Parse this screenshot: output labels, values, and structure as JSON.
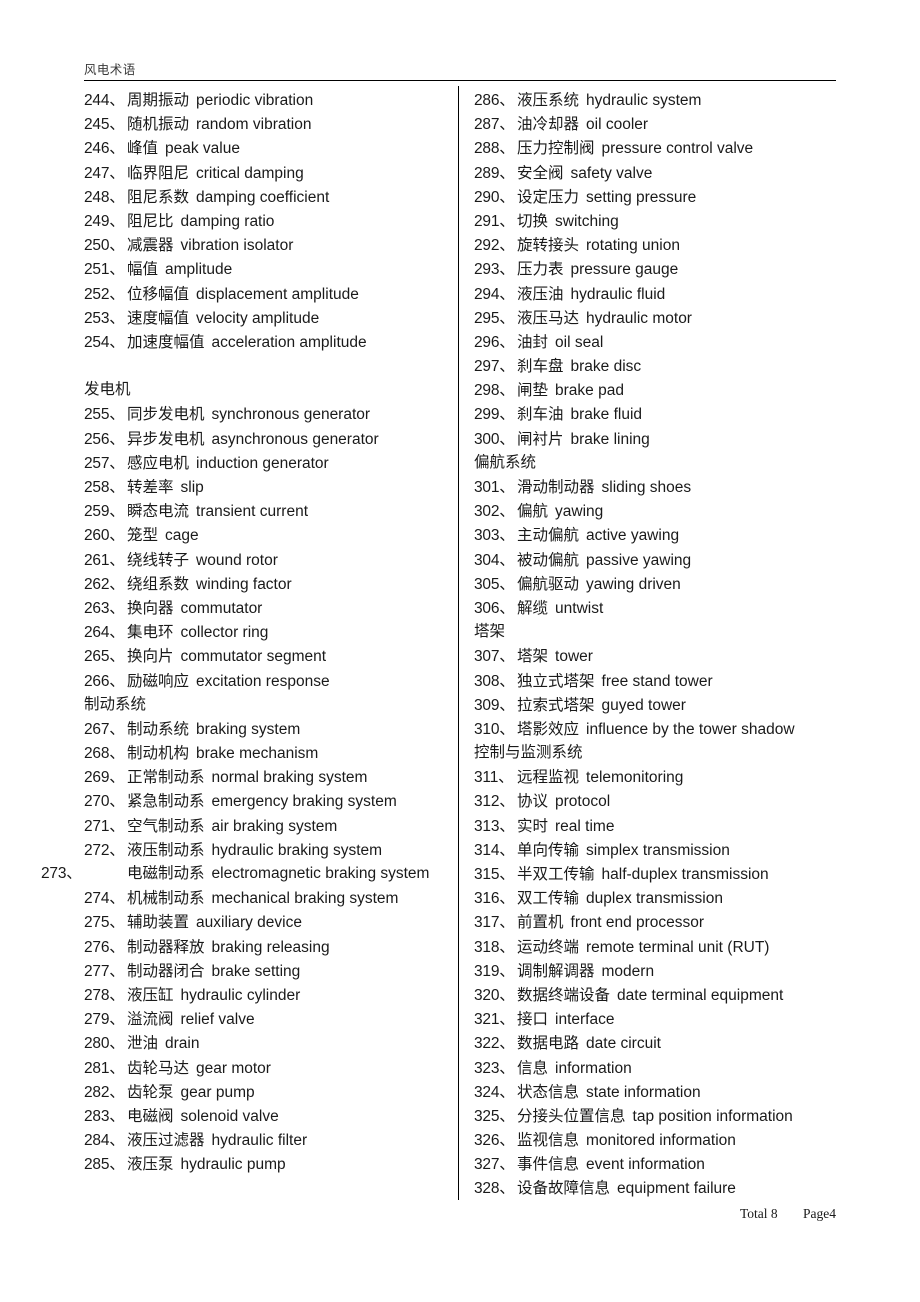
{
  "header": {
    "title": "风电术语"
  },
  "footer": {
    "total_label": "Total 8",
    "page_label": "Page4"
  },
  "columns": {
    "left": [
      {
        "kind": "entry",
        "num": "244、",
        "term": "周期振动",
        "en": "periodic vibration"
      },
      {
        "kind": "entry",
        "num": "245、",
        "term": "随机振动",
        "en": "random vibration"
      },
      {
        "kind": "entry",
        "num": "246、",
        "term": "峰值",
        "en": "peak value"
      },
      {
        "kind": "entry",
        "num": "247、",
        "term": "临界阻尼",
        "en": "critical damping"
      },
      {
        "kind": "entry",
        "num": "248、",
        "term": "阻尼系数",
        "en": "damping coefficient"
      },
      {
        "kind": "entry",
        "num": "249、",
        "term": "阻尼比",
        "en": "damping ratio"
      },
      {
        "kind": "entry",
        "num": "250、",
        "term": "减震器",
        "en": "vibration isolator"
      },
      {
        "kind": "entry",
        "num": "251、",
        "term": "幅值",
        "en": "amplitude"
      },
      {
        "kind": "entry",
        "num": "252、",
        "term": "位移幅值",
        "en": "displacement amplitude"
      },
      {
        "kind": "entry",
        "num": "253、",
        "term": "速度幅值",
        "en": "velocity amplitude"
      },
      {
        "kind": "entry",
        "num": "254、",
        "term": "加速度幅值",
        "en": "acceleration amplitude"
      },
      {
        "kind": "spacer"
      },
      {
        "kind": "section",
        "label": "发电机"
      },
      {
        "kind": "entry",
        "num": "255、",
        "term": "同步发电机",
        "en": "synchronous generator"
      },
      {
        "kind": "entry",
        "num": "256、",
        "term": "异步发电机",
        "en": "asynchronous generator"
      },
      {
        "kind": "entry",
        "num": "257、",
        "term": "感应电机",
        "en": "induction generator"
      },
      {
        "kind": "entry",
        "num": "258、",
        "term": "转差率",
        "en": "slip"
      },
      {
        "kind": "entry",
        "num": "259、",
        "term": "瞬态电流",
        "en": "transient current"
      },
      {
        "kind": "entry",
        "num": "260、",
        "term": "笼型",
        "en": "cage"
      },
      {
        "kind": "entry",
        "num": "261、",
        "term": "绕线转子",
        "en": "wound rotor"
      },
      {
        "kind": "entry",
        "num": "262、",
        "term": "绕组系数",
        "en": "winding factor"
      },
      {
        "kind": "entry",
        "num": "263、",
        "term": "换向器",
        "en": "commutator"
      },
      {
        "kind": "entry",
        "num": "264、",
        "term": "集电环",
        "en": "collector ring"
      },
      {
        "kind": "entry",
        "num": "265、",
        "term": "换向片",
        "en": "commutator segment"
      },
      {
        "kind": "entry",
        "num": "266、",
        "term": "励磁响应",
        "en": "excitation response"
      },
      {
        "kind": "section",
        "label": "制动系统"
      },
      {
        "kind": "entry",
        "num": "267、",
        "term": "制动系统",
        "en": "braking system"
      },
      {
        "kind": "entry",
        "num": "268、",
        "term": "制动机构",
        "en": "brake mechanism"
      },
      {
        "kind": "entry",
        "num": "269、",
        "term": "正常制动系",
        "en": "normal braking system"
      },
      {
        "kind": "entry",
        "num": "270、",
        "term": "紧急制动系",
        "en": "emergency braking system"
      },
      {
        "kind": "entry",
        "num": "271、",
        "term": "空气制动系",
        "en": "air braking system"
      },
      {
        "kind": "entry",
        "num": "272、",
        "term": "液压制动系",
        "en": "hydraulic braking system"
      },
      {
        "kind": "entry-wrap",
        "num": "273、",
        "term": "电磁制动系",
        "en": "electromagnetic braking system"
      },
      {
        "kind": "entry",
        "num": "274、",
        "term": "机械制动系",
        "en": "mechanical braking system"
      },
      {
        "kind": "entry",
        "num": "275、",
        "term": "辅助装置",
        "en": "auxiliary device"
      },
      {
        "kind": "entry",
        "num": "276、",
        "term": "制动器释放",
        "en": "braking releasing"
      },
      {
        "kind": "entry",
        "num": "277、",
        "term": "制动器闭合",
        "en": "brake setting"
      },
      {
        "kind": "entry",
        "num": "278、",
        "term": "液压缸",
        "en": "hydraulic cylinder"
      },
      {
        "kind": "entry",
        "num": "279、",
        "term": "溢流阀",
        "en": "relief valve"
      },
      {
        "kind": "entry",
        "num": "280、",
        "term": "泄油",
        "en": "drain"
      },
      {
        "kind": "entry",
        "num": "281、",
        "term": "齿轮马达",
        "en": "gear motor"
      },
      {
        "kind": "entry",
        "num": "282、",
        "term": "齿轮泵",
        "en": "gear pump"
      },
      {
        "kind": "entry",
        "num": "283、",
        "term": "电磁阀",
        "en": "solenoid valve"
      },
      {
        "kind": "entry",
        "num": "284、",
        "term": "液压过滤器",
        "en": "hydraulic filter"
      },
      {
        "kind": "entry",
        "num": "285、",
        "term": "液压泵",
        "en": "hydraulic pump"
      }
    ],
    "right": [
      {
        "kind": "entry",
        "num": "286、",
        "term": "液压系统",
        "en": "hydraulic system"
      },
      {
        "kind": "entry",
        "num": "287、",
        "term": "油冷却器",
        "en": "oil cooler"
      },
      {
        "kind": "entry",
        "num": "288、",
        "term": "压力控制阀",
        "en": "pressure control valve"
      },
      {
        "kind": "entry",
        "num": "289、",
        "term": "安全阀",
        "en": "safety valve"
      },
      {
        "kind": "entry",
        "num": "290、",
        "term": "设定压力",
        "en": "setting pressure"
      },
      {
        "kind": "entry",
        "num": "291、",
        "term": "切换",
        "en": "switching"
      },
      {
        "kind": "entry",
        "num": "292、",
        "term": "旋转接头",
        "en": "rotating union"
      },
      {
        "kind": "entry",
        "num": "293、",
        "term": "压力表",
        "en": "pressure gauge"
      },
      {
        "kind": "entry",
        "num": "294、",
        "term": "液压油",
        "en": "hydraulic fluid"
      },
      {
        "kind": "entry",
        "num": "295、",
        "term": "液压马达",
        "en": "hydraulic motor"
      },
      {
        "kind": "entry",
        "num": "296、",
        "term": "油封",
        "en": "oil seal"
      },
      {
        "kind": "entry",
        "num": "297、",
        "term": "刹车盘",
        "en": "brake disc"
      },
      {
        "kind": "entry",
        "num": "298、",
        "term": "闸垫",
        "en": "brake pad"
      },
      {
        "kind": "entry",
        "num": "299、",
        "term": "刹车油",
        "en": "brake fluid"
      },
      {
        "kind": "entry",
        "num": "300、",
        "term": "闸衬片",
        "en": "brake lining"
      },
      {
        "kind": "section",
        "label": "偏航系统"
      },
      {
        "kind": "entry",
        "num": "301、",
        "term": "滑动制动器",
        "en": "sliding shoes"
      },
      {
        "kind": "entry",
        "num": "302、",
        "term": "偏航",
        "en": "yawing"
      },
      {
        "kind": "entry",
        "num": "303、",
        "term": "主动偏航",
        "en": "active yawing"
      },
      {
        "kind": "entry",
        "num": "304、",
        "term": "被动偏航",
        "en": "passive yawing"
      },
      {
        "kind": "entry",
        "num": "305、",
        "term": "偏航驱动",
        "en": "yawing driven"
      },
      {
        "kind": "entry",
        "num": "306、",
        "term": "解缆",
        "en": "untwist"
      },
      {
        "kind": "section",
        "label": "塔架"
      },
      {
        "kind": "entry",
        "num": "307、",
        "term": "塔架",
        "en": "tower"
      },
      {
        "kind": "entry",
        "num": "308、",
        "term": "独立式塔架",
        "en": "free stand tower"
      },
      {
        "kind": "entry",
        "num": "309、",
        "term": "拉索式塔架",
        "en": "guyed tower"
      },
      {
        "kind": "entry",
        "num": "310、",
        "term": "塔影效应",
        "en": "influence by the tower shadow"
      },
      {
        "kind": "section",
        "label": "控制与监测系统"
      },
      {
        "kind": "entry",
        "num": "311、",
        "term": "远程监视",
        "en": "telemonitoring"
      },
      {
        "kind": "entry",
        "num": "312、",
        "term": "协议",
        "en": "protocol"
      },
      {
        "kind": "entry",
        "num": "313、",
        "term": "实时",
        "en": "real time"
      },
      {
        "kind": "entry",
        "num": "314、",
        "term": "单向传输",
        "en": "simplex transmission"
      },
      {
        "kind": "entry",
        "num": "315、",
        "term": "半双工传输",
        "en": "half-duplex transmission"
      },
      {
        "kind": "entry",
        "num": "316、",
        "term": "双工传输",
        "en": "duplex transmission"
      },
      {
        "kind": "entry",
        "num": "317、",
        "term": "前置机",
        "en": "front end processor"
      },
      {
        "kind": "entry",
        "num": "318、",
        "term": "运动终端",
        "en": "remote terminal unit (RUT)"
      },
      {
        "kind": "entry",
        "num": "319、",
        "term": "调制解调器",
        "en": "modern"
      },
      {
        "kind": "entry",
        "num": "320、",
        "term": "数据终端设备",
        "en": "date terminal equipment"
      },
      {
        "kind": "entry",
        "num": "321、",
        "term": "接口",
        "en": "interface"
      },
      {
        "kind": "entry",
        "num": "322、",
        "term": "数据电路",
        "en": "date circuit"
      },
      {
        "kind": "entry",
        "num": "323、",
        "term": "信息",
        "en": "information"
      },
      {
        "kind": "entry",
        "num": "324、",
        "term": "状态信息",
        "en": "state information"
      },
      {
        "kind": "entry",
        "num": "325、",
        "term": "分接头位置信息",
        "en": "tap position information"
      },
      {
        "kind": "entry",
        "num": "326、",
        "term": "监视信息",
        "en": "monitored information"
      },
      {
        "kind": "entry",
        "num": "327、",
        "term": "事件信息",
        "en": "event information"
      },
      {
        "kind": "entry",
        "num": "328、",
        "term": "设备故障信息",
        "en": "equipment failure"
      }
    ]
  }
}
